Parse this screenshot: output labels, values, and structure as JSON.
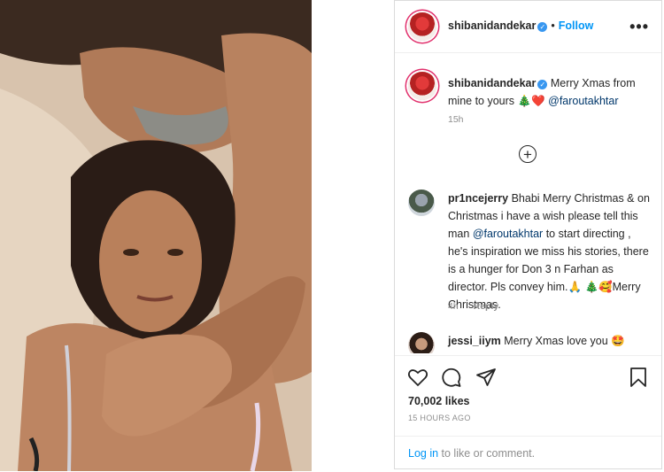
{
  "post": {
    "username": "shibanidandekar",
    "follow_label": "Follow",
    "separator": "•",
    "more_label": "•••"
  },
  "caption": {
    "username": "shibanidandekar",
    "text": "Merry Xmas from mine to yours 🎄❤️",
    "mention": "@faroutakhtar",
    "time": "15h"
  },
  "load_more_label": "+",
  "comments": [
    {
      "username": "pr1ncejerry",
      "text_before": "Bhabi Merry Christmas & on Christmas i have a wish please tell this man",
      "mention": "@faroutakhtar",
      "text_after": "to start directing , he's inspiration we miss his stories, there is a hunger for Don 3 n Farhan as director. Pls convey him.🙏 🎄🥰Merry Christmas.",
      "time": "4h",
      "reply_label": "Reply"
    },
    {
      "username": "jessi_iiym",
      "text": "Merry Xmas love you 🤩"
    }
  ],
  "actions": {
    "likes": "70,002 likes",
    "posted_ago": "15 HOURS AGO"
  },
  "login": {
    "link_text": "Log in",
    "rest_text": " to like or comment."
  },
  "icons": [
    "heart-icon",
    "comment-icon",
    "share-icon",
    "bookmark-icon",
    "plus-circle-icon",
    "verified-badge-icon"
  ],
  "colors": {
    "link_blue": "#0095f6",
    "verified": "#3897f0",
    "mention": "#00376b",
    "meta_grey": "#8e8e8e"
  }
}
